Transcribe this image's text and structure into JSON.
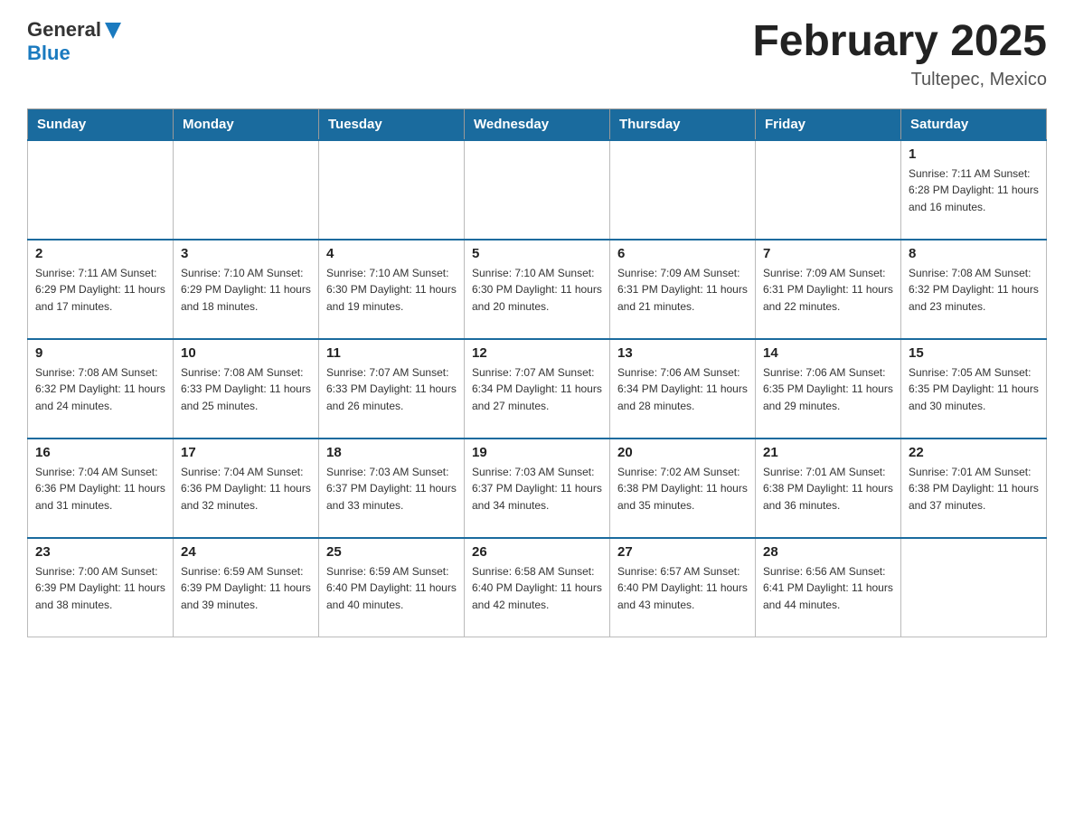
{
  "header": {
    "logo": {
      "general": "General",
      "blue": "Blue"
    },
    "title": "February 2025",
    "location": "Tultepec, Mexico"
  },
  "weekdays": [
    "Sunday",
    "Monday",
    "Tuesday",
    "Wednesday",
    "Thursday",
    "Friday",
    "Saturday"
  ],
  "weeks": [
    [
      {
        "day": "",
        "info": ""
      },
      {
        "day": "",
        "info": ""
      },
      {
        "day": "",
        "info": ""
      },
      {
        "day": "",
        "info": ""
      },
      {
        "day": "",
        "info": ""
      },
      {
        "day": "",
        "info": ""
      },
      {
        "day": "1",
        "info": "Sunrise: 7:11 AM\nSunset: 6:28 PM\nDaylight: 11 hours\nand 16 minutes."
      }
    ],
    [
      {
        "day": "2",
        "info": "Sunrise: 7:11 AM\nSunset: 6:29 PM\nDaylight: 11 hours\nand 17 minutes."
      },
      {
        "day": "3",
        "info": "Sunrise: 7:10 AM\nSunset: 6:29 PM\nDaylight: 11 hours\nand 18 minutes."
      },
      {
        "day": "4",
        "info": "Sunrise: 7:10 AM\nSunset: 6:30 PM\nDaylight: 11 hours\nand 19 minutes."
      },
      {
        "day": "5",
        "info": "Sunrise: 7:10 AM\nSunset: 6:30 PM\nDaylight: 11 hours\nand 20 minutes."
      },
      {
        "day": "6",
        "info": "Sunrise: 7:09 AM\nSunset: 6:31 PM\nDaylight: 11 hours\nand 21 minutes."
      },
      {
        "day": "7",
        "info": "Sunrise: 7:09 AM\nSunset: 6:31 PM\nDaylight: 11 hours\nand 22 minutes."
      },
      {
        "day": "8",
        "info": "Sunrise: 7:08 AM\nSunset: 6:32 PM\nDaylight: 11 hours\nand 23 minutes."
      }
    ],
    [
      {
        "day": "9",
        "info": "Sunrise: 7:08 AM\nSunset: 6:32 PM\nDaylight: 11 hours\nand 24 minutes."
      },
      {
        "day": "10",
        "info": "Sunrise: 7:08 AM\nSunset: 6:33 PM\nDaylight: 11 hours\nand 25 minutes."
      },
      {
        "day": "11",
        "info": "Sunrise: 7:07 AM\nSunset: 6:33 PM\nDaylight: 11 hours\nand 26 minutes."
      },
      {
        "day": "12",
        "info": "Sunrise: 7:07 AM\nSunset: 6:34 PM\nDaylight: 11 hours\nand 27 minutes."
      },
      {
        "day": "13",
        "info": "Sunrise: 7:06 AM\nSunset: 6:34 PM\nDaylight: 11 hours\nand 28 minutes."
      },
      {
        "day": "14",
        "info": "Sunrise: 7:06 AM\nSunset: 6:35 PM\nDaylight: 11 hours\nand 29 minutes."
      },
      {
        "day": "15",
        "info": "Sunrise: 7:05 AM\nSunset: 6:35 PM\nDaylight: 11 hours\nand 30 minutes."
      }
    ],
    [
      {
        "day": "16",
        "info": "Sunrise: 7:04 AM\nSunset: 6:36 PM\nDaylight: 11 hours\nand 31 minutes."
      },
      {
        "day": "17",
        "info": "Sunrise: 7:04 AM\nSunset: 6:36 PM\nDaylight: 11 hours\nand 32 minutes."
      },
      {
        "day": "18",
        "info": "Sunrise: 7:03 AM\nSunset: 6:37 PM\nDaylight: 11 hours\nand 33 minutes."
      },
      {
        "day": "19",
        "info": "Sunrise: 7:03 AM\nSunset: 6:37 PM\nDaylight: 11 hours\nand 34 minutes."
      },
      {
        "day": "20",
        "info": "Sunrise: 7:02 AM\nSunset: 6:38 PM\nDaylight: 11 hours\nand 35 minutes."
      },
      {
        "day": "21",
        "info": "Sunrise: 7:01 AM\nSunset: 6:38 PM\nDaylight: 11 hours\nand 36 minutes."
      },
      {
        "day": "22",
        "info": "Sunrise: 7:01 AM\nSunset: 6:38 PM\nDaylight: 11 hours\nand 37 minutes."
      }
    ],
    [
      {
        "day": "23",
        "info": "Sunrise: 7:00 AM\nSunset: 6:39 PM\nDaylight: 11 hours\nand 38 minutes."
      },
      {
        "day": "24",
        "info": "Sunrise: 6:59 AM\nSunset: 6:39 PM\nDaylight: 11 hours\nand 39 minutes."
      },
      {
        "day": "25",
        "info": "Sunrise: 6:59 AM\nSunset: 6:40 PM\nDaylight: 11 hours\nand 40 minutes."
      },
      {
        "day": "26",
        "info": "Sunrise: 6:58 AM\nSunset: 6:40 PM\nDaylight: 11 hours\nand 42 minutes."
      },
      {
        "day": "27",
        "info": "Sunrise: 6:57 AM\nSunset: 6:40 PM\nDaylight: 11 hours\nand 43 minutes."
      },
      {
        "day": "28",
        "info": "Sunrise: 6:56 AM\nSunset: 6:41 PM\nDaylight: 11 hours\nand 44 minutes."
      },
      {
        "day": "",
        "info": ""
      }
    ]
  ]
}
